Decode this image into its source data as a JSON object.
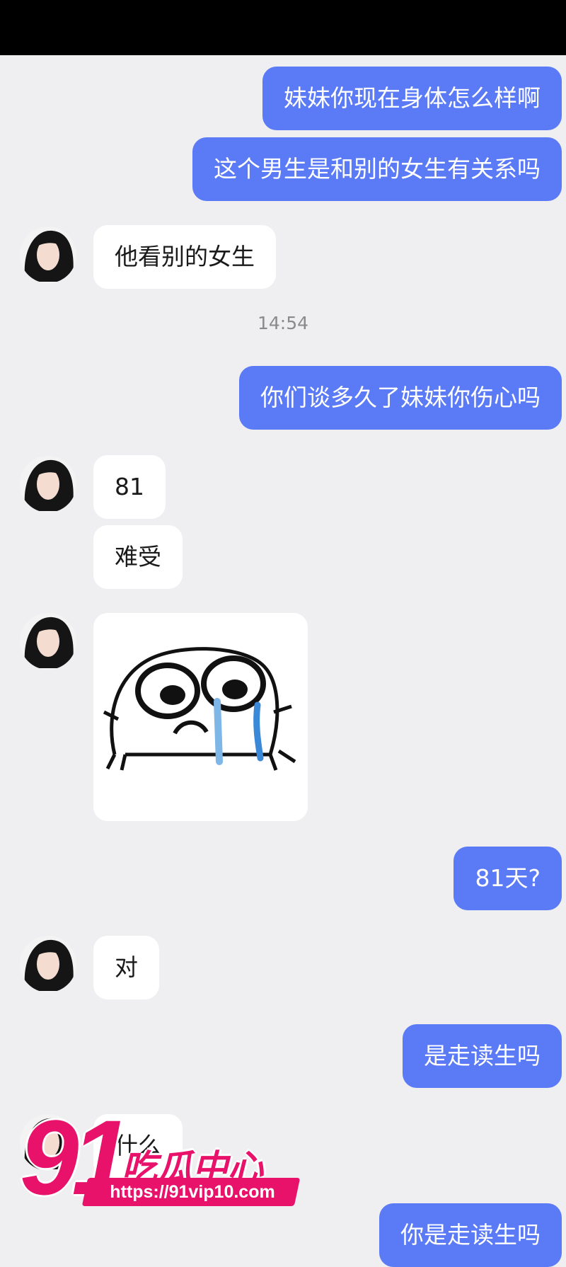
{
  "chat": {
    "timestamp": "14:54",
    "messages": [
      {
        "from": "me",
        "text": "妹妹你现在身体怎么样啊"
      },
      {
        "from": "me",
        "text": "这个男生是和别的女生有关系吗"
      },
      {
        "from": "other",
        "text": "他看别的女生"
      },
      {
        "from": "me",
        "text": "你们谈多久了妹妹你伤心吗"
      },
      {
        "from": "other",
        "text": "81"
      },
      {
        "from": "other",
        "text": "难受"
      },
      {
        "from": "other",
        "sticker": "crying-face-sticker"
      },
      {
        "from": "me",
        "text": "81天?"
      },
      {
        "from": "other",
        "text": "对"
      },
      {
        "from": "me",
        "text": "是走读生吗"
      },
      {
        "from": "other",
        "text": "什么"
      },
      {
        "from": "me",
        "text": "你是走读生吗"
      }
    ]
  },
  "watermark": {
    "number": "91",
    "name": "吃瓜中心",
    "url": "https://91vip10.com"
  },
  "colors": {
    "outgoing_bubble": "#5b7af5",
    "incoming_bubble": "#ffffff",
    "background": "#efeff1",
    "watermark": "#e8126a"
  }
}
